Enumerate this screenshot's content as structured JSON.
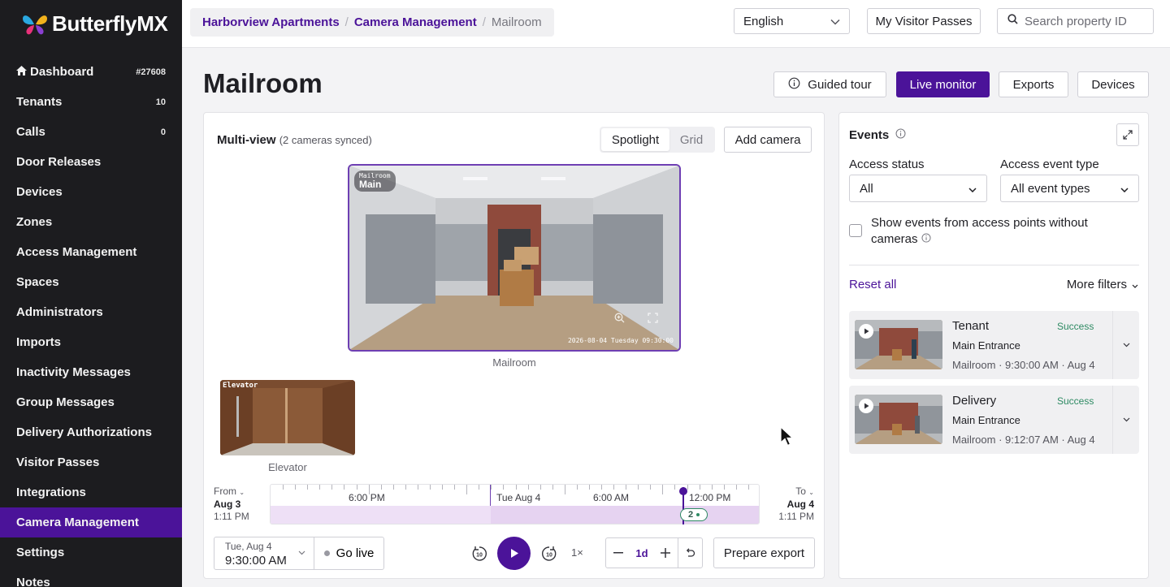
{
  "brand": {
    "name": "ButterflyMX"
  },
  "sidebar": {
    "items": [
      {
        "label": "Dashboard",
        "count": "#27608",
        "icon": "home-icon"
      },
      {
        "label": "Tenants",
        "count": "10"
      },
      {
        "label": "Calls",
        "count": "0"
      },
      {
        "label": "Door Releases",
        "count": ""
      },
      {
        "label": "Devices",
        "count": ""
      },
      {
        "label": "Zones",
        "count": ""
      },
      {
        "label": "Access Management",
        "count": ""
      },
      {
        "label": "Spaces",
        "count": ""
      },
      {
        "label": "Administrators",
        "count": ""
      },
      {
        "label": "Imports",
        "count": ""
      },
      {
        "label": "Inactivity Messages",
        "count": ""
      },
      {
        "label": "Group Messages",
        "count": ""
      },
      {
        "label": "Delivery Authorizations",
        "count": ""
      },
      {
        "label": "Visitor Passes",
        "count": ""
      },
      {
        "label": "Integrations",
        "count": ""
      },
      {
        "label": "Camera Management",
        "count": "",
        "active": true
      },
      {
        "label": "Settings",
        "count": ""
      },
      {
        "label": "Notes",
        "count": ""
      }
    ]
  },
  "header": {
    "breadcrumb": [
      "Harborview Apartments",
      "Camera Management",
      "Mailroom"
    ],
    "language": "English",
    "visitor_passes": "My Visitor Passes",
    "search_placeholder": "Search property ID"
  },
  "page": {
    "title": "Mailroom",
    "actions": {
      "guided_tour": "Guided tour",
      "live_monitor": "Live monitor",
      "exports": "Exports",
      "devices": "Devices"
    }
  },
  "multiview": {
    "title": "Multi-view",
    "subtitle": "(2 cameras synced)",
    "view_modes": [
      "Spotlight",
      "Grid"
    ],
    "selected_mode": "Spotlight",
    "add_camera": "Add camera",
    "cameras": [
      {
        "name": "Mailroom",
        "overlay_small": "Mailroom",
        "tag": "Main",
        "timestamp": "2026-08-04 Tuesday 09:30:00"
      },
      {
        "name": "Elevator",
        "overlay_small": "Elevator"
      }
    ]
  },
  "timeline": {
    "from_label": "From",
    "from_date": "Aug 3",
    "from_time": "1:11 PM",
    "to_label": "To",
    "to_date": "Aug 4",
    "to_time": "1:11 PM",
    "labels": [
      "6:00 PM",
      "Tue  Aug 4",
      "6:00 AM",
      "12:00 PM"
    ],
    "event_count": "2",
    "playhead_fraction": 0.84
  },
  "controls": {
    "date_line1": "Tue, Aug 4",
    "date_line2": "9:30:00 AM",
    "go_live": "Go live",
    "skip_back": "10",
    "skip_forward": "10",
    "speed": "1×",
    "zoom_value": "1d",
    "prepare_export": "Prepare export"
  },
  "events": {
    "title": "Events",
    "access_status_label": "Access status",
    "access_status_value": "All",
    "event_type_label": "Access event type",
    "event_type_value": "All event types",
    "checkbox_label": "Show events from access points without cameras",
    "reset": "Reset all",
    "more_filters": "More filters",
    "items": [
      {
        "name": "Tenant",
        "status": "Success",
        "location": "Main Entrance",
        "meta": "Mailroom · 9:30:00 AM · Aug 4"
      },
      {
        "name": "Delivery",
        "status": "Success",
        "location": "Main Entrance",
        "meta": "Mailroom · 9:12:07 AM · Aug 4"
      }
    ]
  },
  "colors": {
    "accent": "#4b1399",
    "sidebar": "#1c1c1f",
    "success": "#2e8a63"
  }
}
